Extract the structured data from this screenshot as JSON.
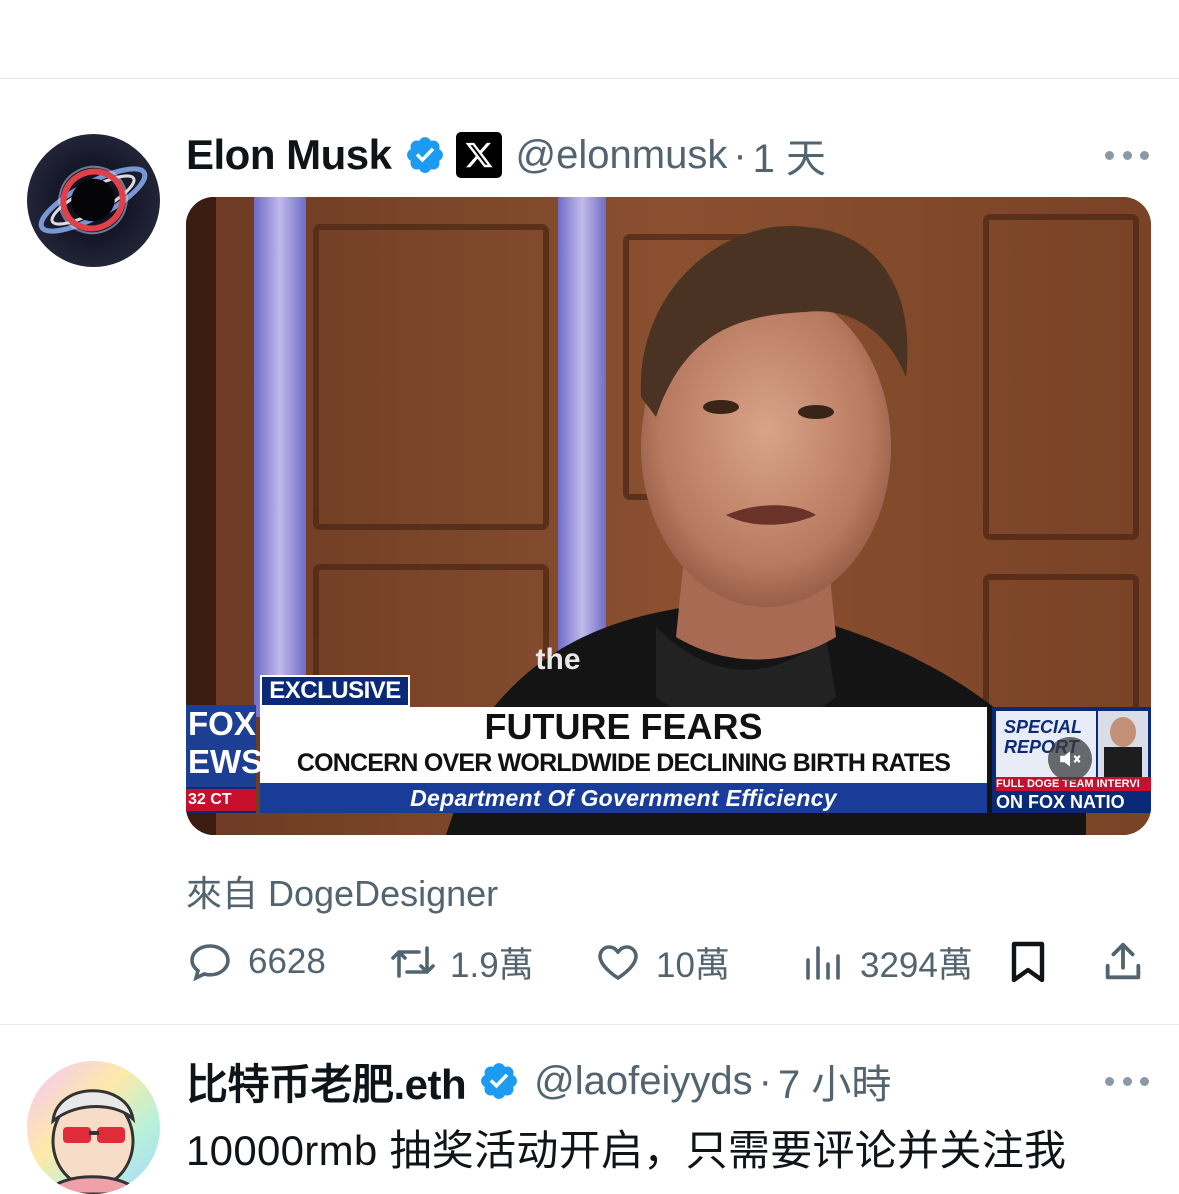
{
  "tweets": [
    {
      "author_name": "Elon Musk",
      "handle": "@elonmusk",
      "separator": "·",
      "time": "1 天",
      "avatar_icon": "black-hole-avatar",
      "verified_icon": "verified-badge-icon",
      "affiliation_icon": "x-logo-icon",
      "media": {
        "type": "video",
        "caption_word": "the",
        "tag": "EXCLUSIVE",
        "network_top": "FOX",
        "network_bottom": "EWS",
        "clock": "32 CT",
        "headline": "FUTURE FEARS",
        "subheadline": "CONCERN OVER WORLDWIDE DECLINING BIRTH RATES",
        "ticker": "Department Of Government Efficiency",
        "side_title_1": "SPECIAL",
        "side_title_2": "REPORT",
        "side_promo_1": "FULL DOGE TEAM INTERVI",
        "side_promo_2": "ON FOX NATIO",
        "mute_icon": "mute-icon"
      },
      "source": "來自 DogeDesigner",
      "actions": {
        "replies": "6628",
        "reposts": "1.9萬",
        "likes": "10萬",
        "views": "3294萬"
      }
    },
    {
      "author_name": "比特币老肥.eth",
      "handle": "@laofeiyyds",
      "separator": "·",
      "time": "7 小時",
      "verified_icon": "verified-badge-icon",
      "text": "10000rmb 抽奖活动开启，只需要评论并关注我"
    }
  ],
  "colors": {
    "verified": "#1d9bf0",
    "secondary_text": "#536471",
    "divider": "#e6e9ec",
    "fox_blue": "#0a2a78",
    "fox_red": "#c8102e"
  }
}
